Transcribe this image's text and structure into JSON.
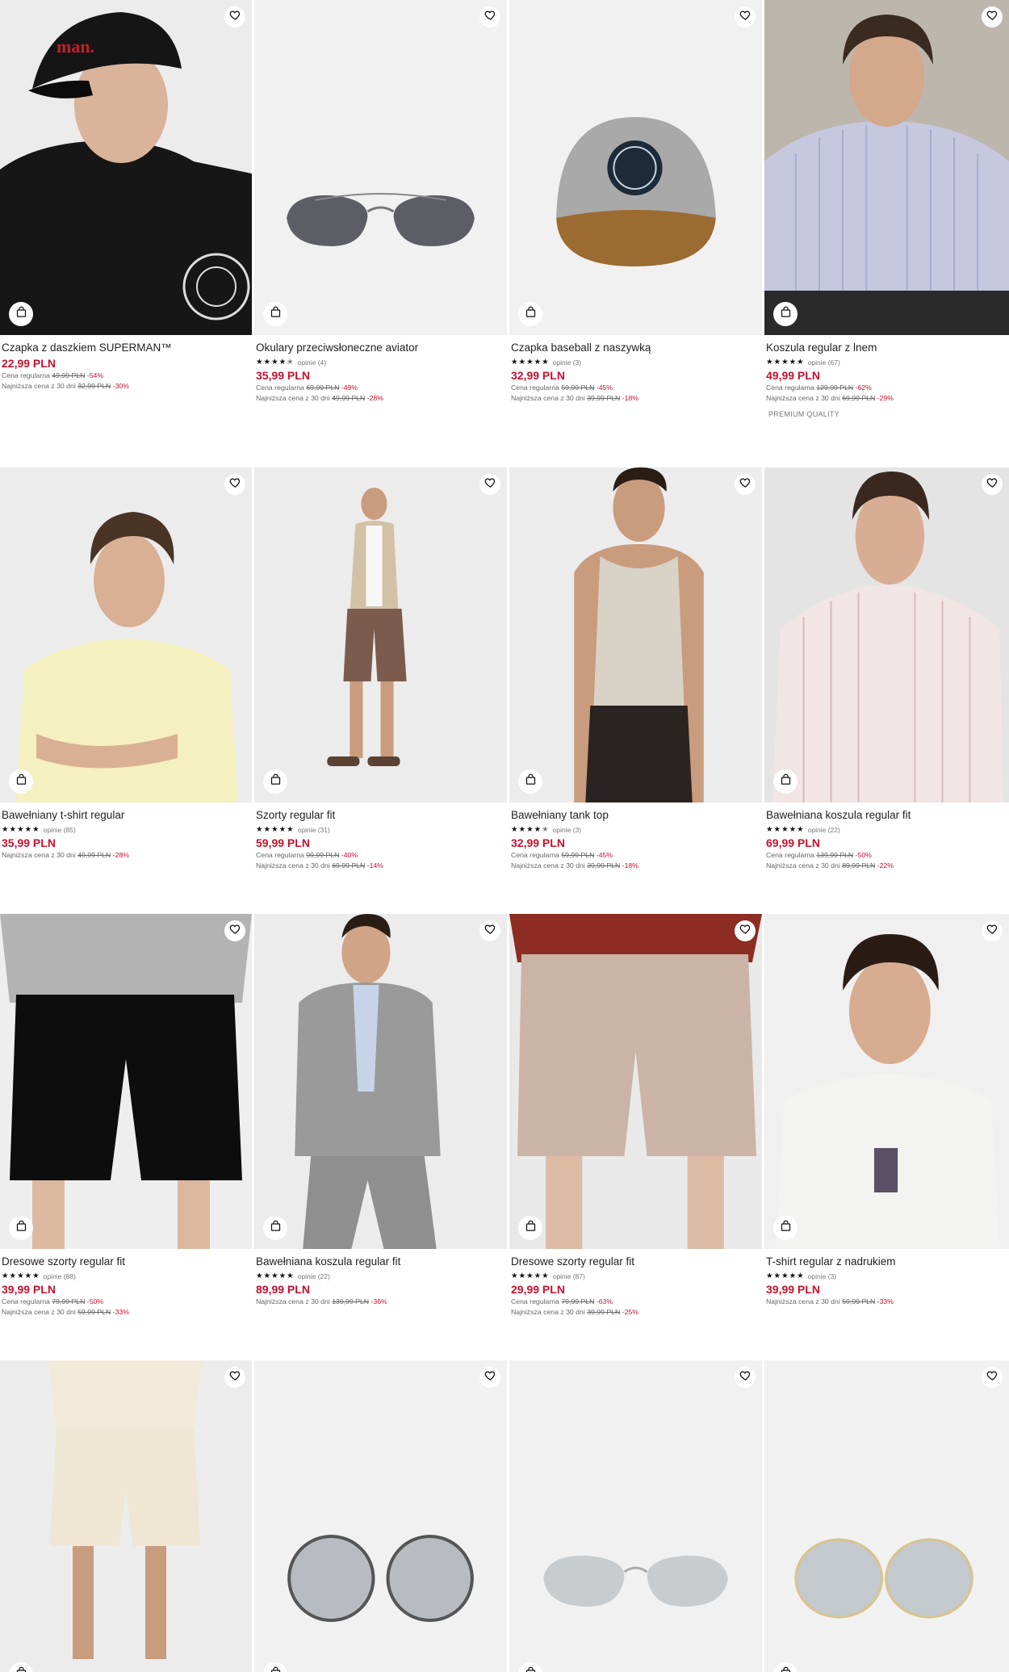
{
  "ui": {
    "fav_icon": "heart-outline-icon",
    "bag_icon": "shopping-bag-icon",
    "star_icon": "star-icon",
    "price_color": "#c8102e"
  },
  "products": [
    {
      "name": "Czapka z daszkiem SUPERMAN™",
      "rating": null,
      "reviews": "",
      "price": "22,99 PLN",
      "regular_label": "Cena regularna",
      "regular_price": "49,99 PLN",
      "regular_disc": "-54%",
      "lowest_label": "Najniższa cena z 30 dni",
      "lowest_price": "32,99 PLN",
      "lowest_disc": "-30%",
      "badge": ""
    },
    {
      "name": "Okulary przeciwsłoneczne aviator",
      "rating": 4.5,
      "reviews": "opinie (4)",
      "price": "35,99 PLN",
      "regular_label": "Cena regularna",
      "regular_price": "69,99 PLN",
      "regular_disc": "-49%",
      "lowest_label": "Najniższa cena z 30 dni",
      "lowest_price": "49,99 PLN",
      "lowest_disc": "-28%",
      "badge": ""
    },
    {
      "name": "Czapka baseball z naszywką",
      "rating": 5,
      "reviews": "opinie (3)",
      "price": "32,99 PLN",
      "regular_label": "Cena regularna",
      "regular_price": "59,99 PLN",
      "regular_disc": "-45%",
      "lowest_label": "Najniższa cena z 30 dni",
      "lowest_price": "39,99 PLN",
      "lowest_disc": "-18%",
      "badge": ""
    },
    {
      "name": "Koszula regular z lnem",
      "rating": 5,
      "reviews": "opinie (67)",
      "price": "49,99 PLN",
      "regular_label": "Cena regularna",
      "regular_price": "129,99 PLN",
      "regular_disc": "-62%",
      "lowest_label": "Najniższa cena z 30 dni",
      "lowest_price": "69,99 PLN",
      "lowest_disc": "-29%",
      "badge": "PREMIUM QUALITY"
    },
    {
      "name": "Bawełniany t-shirt regular",
      "rating": 5,
      "reviews": "opinie (85)",
      "price": "35,99 PLN",
      "regular_label": "",
      "regular_price": "",
      "regular_disc": "",
      "lowest_label": "Najniższa cena z 30 dni",
      "lowest_price": "49,99 PLN",
      "lowest_disc": "-28%",
      "badge": ""
    },
    {
      "name": "Szorty regular fit",
      "rating": 5,
      "reviews": "opinie (31)",
      "price": "59,99 PLN",
      "regular_label": "Cena regularna",
      "regular_price": "99,99 PLN",
      "regular_disc": "-40%",
      "lowest_label": "Najniższa cena z 30 dni",
      "lowest_price": "69,99 PLN",
      "lowest_disc": "-14%",
      "badge": ""
    },
    {
      "name": "Bawełniany tank top",
      "rating": 4.5,
      "reviews": "opinie (3)",
      "price": "32,99 PLN",
      "regular_label": "Cena regularna",
      "regular_price": "59,99 PLN",
      "regular_disc": "-45%",
      "lowest_label": "Najniższa cena z 30 dni",
      "lowest_price": "39,99 PLN",
      "lowest_disc": "-18%",
      "badge": ""
    },
    {
      "name": "Bawełniana koszula regular fit",
      "rating": 5,
      "reviews": "opinie (22)",
      "price": "69,99 PLN",
      "regular_label": "Cena regularna",
      "regular_price": "139,99 PLN",
      "regular_disc": "-50%",
      "lowest_label": "Najniższa cena z 30 dni",
      "lowest_price": "89,99 PLN",
      "lowest_disc": "-22%",
      "badge": ""
    },
    {
      "name": "Dresowe szorty regular fit",
      "rating": 5,
      "reviews": "opinie (88)",
      "price": "39,99 PLN",
      "regular_label": "Cena regularna",
      "regular_price": "79,99 PLN",
      "regular_disc": "-50%",
      "lowest_label": "Najniższa cena z 30 dni",
      "lowest_price": "59,99 PLN",
      "lowest_disc": "-33%",
      "badge": ""
    },
    {
      "name": "Bawełniana koszula regular fit",
      "rating": 5,
      "reviews": "opinie (22)",
      "price": "89,99 PLN",
      "regular_label": "",
      "regular_price": "",
      "regular_disc": "",
      "lowest_label": "Najniższa cena z 30 dni",
      "lowest_price": "139,99 PLN",
      "lowest_disc": "-36%",
      "badge": ""
    },
    {
      "name": "Dresowe szorty regular fit",
      "rating": 5,
      "reviews": "opinie (87)",
      "price": "29,99 PLN",
      "regular_label": "Cena regularna",
      "regular_price": "79,99 PLN",
      "regular_disc": "-63%",
      "lowest_label": "Najniższa cena z 30 dni",
      "lowest_price": "39,99 PLN",
      "lowest_disc": "-25%",
      "badge": ""
    },
    {
      "name": "T-shirt regular z nadrukiem",
      "rating": 5,
      "reviews": "opinie (3)",
      "price": "39,99 PLN",
      "regular_label": "",
      "regular_price": "",
      "regular_disc": "",
      "lowest_label": "Najniższa cena z 30 dni",
      "lowest_price": "59,99 PLN",
      "lowest_disc": "-33%",
      "badge": ""
    },
    {
      "name": "",
      "rating": null,
      "reviews": "",
      "price": "",
      "regular_label": "",
      "regular_price": "",
      "regular_disc": "",
      "lowest_label": "",
      "lowest_price": "",
      "lowest_disc": "",
      "badge": ""
    },
    {
      "name": "",
      "rating": null,
      "reviews": "",
      "price": "",
      "regular_label": "",
      "regular_price": "",
      "regular_disc": "",
      "lowest_label": "",
      "lowest_price": "",
      "lowest_disc": "",
      "badge": ""
    },
    {
      "name": "",
      "rating": null,
      "reviews": "",
      "price": "",
      "regular_label": "",
      "regular_price": "",
      "regular_disc": "",
      "lowest_label": "",
      "lowest_price": "",
      "lowest_disc": "",
      "badge": ""
    },
    {
      "name": "",
      "rating": null,
      "reviews": "",
      "price": "",
      "regular_label": "",
      "regular_price": "",
      "regular_disc": "",
      "lowest_label": "",
      "lowest_price": "",
      "lowest_disc": "",
      "badge": ""
    }
  ]
}
